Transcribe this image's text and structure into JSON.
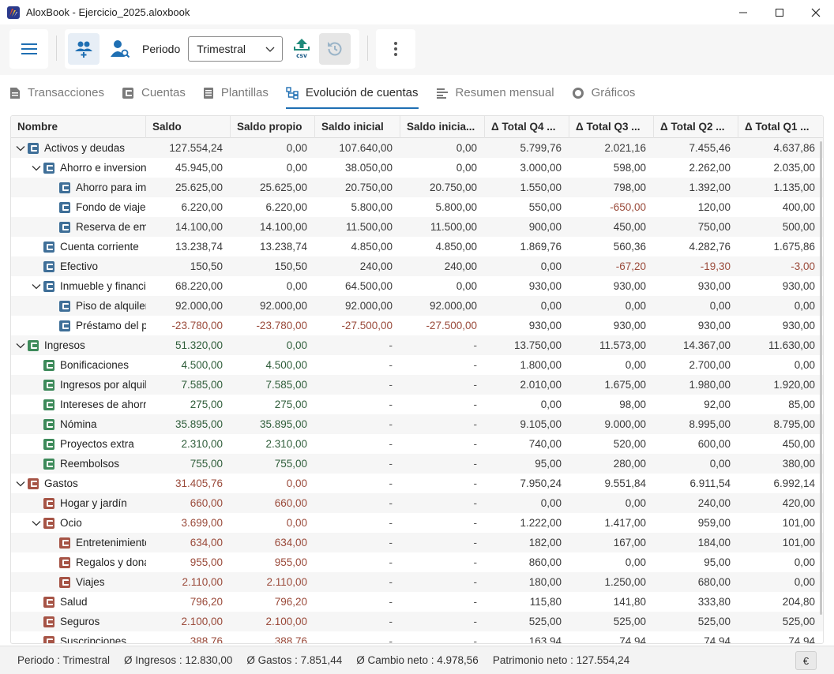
{
  "window": {
    "title": "AloxBook - Ejercicio_2025.aloxbook"
  },
  "toolbar": {
    "periodo_label": "Periodo",
    "periodo_value": "Trimestral",
    "csv_label": "csv"
  },
  "tabs": [
    {
      "label": "Transacciones",
      "icon": "document-icon"
    },
    {
      "label": "Cuentas",
      "icon": "wallet-icon"
    },
    {
      "label": "Plantillas",
      "icon": "template-icon"
    },
    {
      "label": "Evolución de cuentas",
      "icon": "hierarchy-icon"
    },
    {
      "label": "Resumen mensual",
      "icon": "summary-icon"
    },
    {
      "label": "Gráficos",
      "icon": "donut-icon"
    }
  ],
  "table": {
    "columns": [
      "Nombre",
      "Saldo",
      "Saldo propio",
      "Saldo inicial",
      "Saldo inicia...",
      "Δ Total Q4 ...",
      "Δ Total Q3 ...",
      "Δ Total Q2 ...",
      "Δ Total Q1 ..."
    ],
    "rows": [
      {
        "level": 0,
        "expand": true,
        "kind": "asset",
        "name": "Activos y deudas",
        "vals": [
          "127.554,24",
          "0,00",
          "107.640,00",
          "0,00",
          "5.799,76",
          "2.021,16",
          "7.455,46",
          "4.637,86"
        ]
      },
      {
        "level": 1,
        "expand": true,
        "kind": "asset",
        "name": "Ahorro e inversiones",
        "vals": [
          "45.945,00",
          "0,00",
          "38.050,00",
          "0,00",
          "3.000,00",
          "598,00",
          "2.262,00",
          "2.035,00"
        ]
      },
      {
        "level": 2,
        "expand": false,
        "kind": "asset",
        "name": "Ahorro para imprevistos",
        "vals": [
          "25.625,00",
          "25.625,00",
          "20.750,00",
          "20.750,00",
          "1.550,00",
          "798,00",
          "1.392,00",
          "1.135,00"
        ]
      },
      {
        "level": 2,
        "expand": false,
        "kind": "asset",
        "name": "Fondo de viajes",
        "vals": [
          "6.220,00",
          "6.220,00",
          "5.800,00",
          "5.800,00",
          "550,00",
          "-650,00",
          "120,00",
          "400,00"
        ]
      },
      {
        "level": 2,
        "expand": false,
        "kind": "asset",
        "name": "Reserva de emergencia",
        "vals": [
          "14.100,00",
          "14.100,00",
          "11.500,00",
          "11.500,00",
          "900,00",
          "450,00",
          "750,00",
          "500,00"
        ]
      },
      {
        "level": 1,
        "expand": false,
        "kind": "asset",
        "name": "Cuenta corriente",
        "vals": [
          "13.238,74",
          "13.238,74",
          "4.850,00",
          "4.850,00",
          "1.869,76",
          "560,36",
          "4.282,76",
          "1.675,86"
        ]
      },
      {
        "level": 1,
        "expand": false,
        "kind": "asset",
        "name": "Efectivo",
        "vals": [
          "150,50",
          "150,50",
          "240,00",
          "240,00",
          "0,00",
          "-67,20",
          "-19,30",
          "-3,00"
        ]
      },
      {
        "level": 1,
        "expand": true,
        "kind": "asset",
        "name": "Inmueble y financiación",
        "vals": [
          "68.220,00",
          "0,00",
          "64.500,00",
          "0,00",
          "930,00",
          "930,00",
          "930,00",
          "930,00"
        ]
      },
      {
        "level": 2,
        "expand": false,
        "kind": "asset",
        "name": "Piso de alquiler",
        "vals": [
          "92.000,00",
          "92.000,00",
          "92.000,00",
          "92.000,00",
          "0,00",
          "0,00",
          "0,00",
          "0,00"
        ]
      },
      {
        "level": 2,
        "expand": false,
        "kind": "asset",
        "name": "Préstamo del piso",
        "vals": [
          "-23.780,00",
          "-23.780,00",
          "-27.500,00",
          "-27.500,00",
          "930,00",
          "930,00",
          "930,00",
          "930,00"
        ]
      },
      {
        "level": 0,
        "expand": true,
        "kind": "income",
        "name": "Ingresos",
        "vals": [
          "51.320,00",
          "0,00",
          "-",
          "-",
          "13.750,00",
          "11.573,00",
          "14.367,00",
          "11.630,00"
        ]
      },
      {
        "level": 1,
        "expand": false,
        "kind": "income",
        "name": "Bonificaciones",
        "vals": [
          "4.500,00",
          "4.500,00",
          "-",
          "-",
          "1.800,00",
          "0,00",
          "2.700,00",
          "0,00"
        ]
      },
      {
        "level": 1,
        "expand": false,
        "kind": "income",
        "name": "Ingresos por alquiler",
        "vals": [
          "7.585,00",
          "7.585,00",
          "-",
          "-",
          "2.010,00",
          "1.675,00",
          "1.980,00",
          "1.920,00"
        ]
      },
      {
        "level": 1,
        "expand": false,
        "kind": "income",
        "name": "Intereses de ahorro",
        "vals": [
          "275,00",
          "275,00",
          "-",
          "-",
          "0,00",
          "98,00",
          "92,00",
          "85,00"
        ]
      },
      {
        "level": 1,
        "expand": false,
        "kind": "income",
        "name": "Nómina",
        "vals": [
          "35.895,00",
          "35.895,00",
          "-",
          "-",
          "9.105,00",
          "9.000,00",
          "8.995,00",
          "8.795,00"
        ]
      },
      {
        "level": 1,
        "expand": false,
        "kind": "income",
        "name": "Proyectos extra",
        "vals": [
          "2.310,00",
          "2.310,00",
          "-",
          "-",
          "740,00",
          "520,00",
          "600,00",
          "450,00"
        ]
      },
      {
        "level": 1,
        "expand": false,
        "kind": "income",
        "name": "Reembolsos",
        "vals": [
          "755,00",
          "755,00",
          "-",
          "-",
          "95,00",
          "280,00",
          "0,00",
          "380,00"
        ]
      },
      {
        "level": 0,
        "expand": true,
        "kind": "expense",
        "name": "Gastos",
        "vals": [
          "31.405,76",
          "0,00",
          "-",
          "-",
          "7.950,24",
          "9.551,84",
          "6.911,54",
          "6.992,14"
        ]
      },
      {
        "level": 1,
        "expand": false,
        "kind": "expense",
        "name": "Hogar y jardín",
        "vals": [
          "660,00",
          "660,00",
          "-",
          "-",
          "0,00",
          "0,00",
          "240,00",
          "420,00"
        ]
      },
      {
        "level": 1,
        "expand": true,
        "kind": "expense",
        "name": "Ocio",
        "vals": [
          "3.699,00",
          "0,00",
          "-",
          "-",
          "1.222,00",
          "1.417,00",
          "959,00",
          "101,00"
        ]
      },
      {
        "level": 2,
        "expand": false,
        "kind": "expense",
        "name": "Entretenimiento",
        "vals": [
          "634,00",
          "634,00",
          "-",
          "-",
          "182,00",
          "167,00",
          "184,00",
          "101,00"
        ]
      },
      {
        "level": 2,
        "expand": false,
        "kind": "expense",
        "name": "Regalos y donaciones",
        "vals": [
          "955,00",
          "955,00",
          "-",
          "-",
          "860,00",
          "0,00",
          "95,00",
          "0,00"
        ]
      },
      {
        "level": 2,
        "expand": false,
        "kind": "expense",
        "name": "Viajes",
        "vals": [
          "2.110,00",
          "2.110,00",
          "-",
          "-",
          "180,00",
          "1.250,00",
          "680,00",
          "0,00"
        ]
      },
      {
        "level": 1,
        "expand": false,
        "kind": "expense",
        "name": "Salud",
        "vals": [
          "796,20",
          "796,20",
          "-",
          "-",
          "115,80",
          "141,80",
          "333,80",
          "204,80"
        ]
      },
      {
        "level": 1,
        "expand": false,
        "kind": "expense",
        "name": "Seguros",
        "vals": [
          "2.100,00",
          "2.100,00",
          "-",
          "-",
          "525,00",
          "525,00",
          "525,00",
          "525,00"
        ]
      },
      {
        "level": 1,
        "expand": false,
        "kind": "expense",
        "name": "Suscripciones",
        "vals": [
          "388,76",
          "388,76",
          "-",
          "-",
          "163,94",
          "74,94",
          "74,94",
          "74,94"
        ]
      }
    ]
  },
  "status": {
    "periodo": "Periodo : Trimestral",
    "ingresos": "Ø Ingresos : 12.830,00",
    "gastos": "Ø Gastos : 7.851,44",
    "cambio": "Ø Cambio neto : 4.978,56",
    "patrimonio": "Patrimonio neto : 127.554,24",
    "currency": "€"
  },
  "colors": {
    "asset": "#3f6f98",
    "income": "#3d8a5a",
    "expense": "#a65446",
    "accent": "#1f6fb3",
    "negative": "#9a4a3a"
  }
}
